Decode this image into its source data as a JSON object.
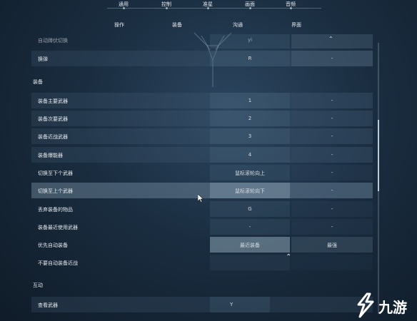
{
  "top_tabs": [
    {
      "label": "通用"
    },
    {
      "label": "控制"
    },
    {
      "label": "准星"
    },
    {
      "label": "画面"
    },
    {
      "label": "音频"
    }
  ],
  "sub_tabs": [
    {
      "label": "操作"
    },
    {
      "label": "装备"
    },
    {
      "label": "沟通"
    },
    {
      "label": "界面"
    }
  ],
  "partial_row": {
    "label": "自动蹲伏切换",
    "v1": "yi"
  },
  "rows_a": [
    {
      "label": "换弹",
      "v1": "R",
      "v2": "-"
    }
  ],
  "section_equip": "装备",
  "rows_equip": [
    {
      "label": "装备主要武器",
      "v1": "1",
      "v2": "-"
    },
    {
      "label": "装备次要武器",
      "v1": "2",
      "v2": "-"
    },
    {
      "label": "装备近战武器",
      "v1": "3",
      "v2": "-"
    },
    {
      "label": "装备爆能器",
      "v1": "4",
      "v2": "-"
    },
    {
      "label": "切换至下个武器",
      "v1": "鼠标滚轮向上",
      "v2": "-"
    },
    {
      "label": "切换至上个武器",
      "v1": "鼠标滚轮向下",
      "v2": "-"
    },
    {
      "label": "丢弃装备的物品",
      "v1": "G",
      "v2": "-"
    },
    {
      "label": "装备最近使用武器",
      "v1": "-",
      "v2": "-"
    },
    {
      "label": "优先自动装备",
      "v1": "最近装备",
      "v2": "最强"
    },
    {
      "label": "不要自动装备近战",
      "v1": "",
      "v2": ""
    }
  ],
  "section_interact": "互动",
  "rows_interact": [
    {
      "label": "查看武器",
      "v1": "Y",
      "v2": ""
    }
  ],
  "watermark": {
    "text": "九游"
  },
  "icons": [
    "emblem-icon",
    "chevron-up-icon",
    "cursor-arrow-icon",
    "watermark-logo-icon"
  ]
}
